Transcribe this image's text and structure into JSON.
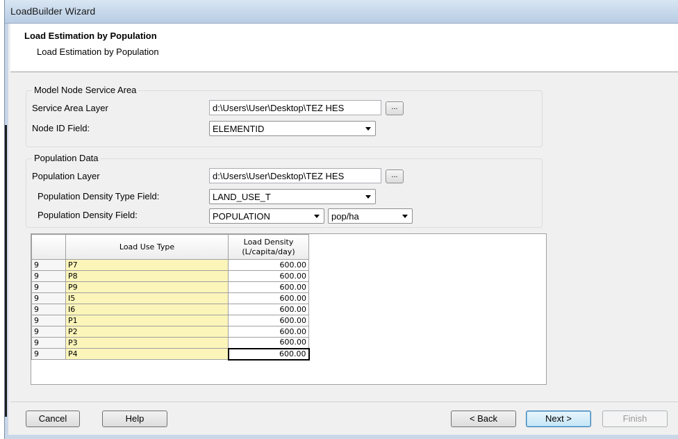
{
  "window": {
    "title": "LoadBuilder Wizard"
  },
  "header": {
    "title": "Load Estimation by Population",
    "subtitle": "Load Estimation by Population"
  },
  "service_area": {
    "legend": "Model Node Service Area",
    "layer_label": "Service Area Layer",
    "layer_value": "d:\\Users\\User\\Desktop\\TEZ HES",
    "browse_label": "...",
    "node_id_label": "Node ID Field:",
    "node_id_value": "ELEMENTID"
  },
  "population": {
    "legend": "Population Data",
    "layer_label": "Population Layer",
    "layer_value": "d:\\Users\\User\\Desktop\\TEZ HES",
    "browse_label": "...",
    "density_type_label": "Population Density Type Field:",
    "density_type_value": "LAND_USE_T",
    "density_label": "Population Density Field:",
    "density_value": "POPULATION",
    "unit_value": "pop/ha"
  },
  "grid": {
    "columns": [
      "Load Use Type",
      "Load Density (L/capita/day)"
    ],
    "rows": [
      {
        "id": "9",
        "type": "P7",
        "density": "600.00"
      },
      {
        "id": "9",
        "type": "P8",
        "density": "600.00"
      },
      {
        "id": "9",
        "type": "P9",
        "density": "600.00"
      },
      {
        "id": "9",
        "type": "I5",
        "density": "600.00"
      },
      {
        "id": "9",
        "type": "I6",
        "density": "600.00"
      },
      {
        "id": "9",
        "type": "P1",
        "density": "600.00"
      },
      {
        "id": "9",
        "type": "P2",
        "density": "600.00"
      },
      {
        "id": "9",
        "type": "P3",
        "density": "600.00"
      },
      {
        "id": "9",
        "type": "P4",
        "density": "600.00"
      }
    ]
  },
  "buttons": {
    "cancel": "Cancel",
    "help": "Help",
    "back": "< Back",
    "next": "Next >",
    "finish": "Finish"
  }
}
